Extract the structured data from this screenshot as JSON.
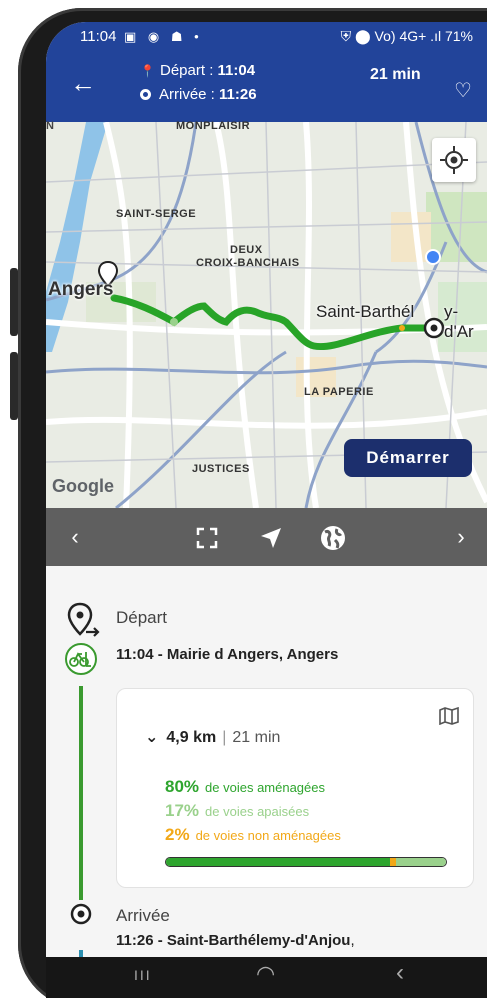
{
  "status_bar": {
    "time": "11:04",
    "left_icons": "▣ ◉ ☗ •",
    "right_text": "⛨ ⬤ Vo) 4G+ .ıl 71%"
  },
  "header": {
    "back_icon": "arrow-left-icon",
    "departure_label": "Départ : ",
    "departure_time": "11:04",
    "arrival_label": "Arrivée : ",
    "arrival_time": "11:26",
    "duration": "21 min",
    "favorite_icon": "heart-outline-icon"
  },
  "map": {
    "labels": {
      "monplaisir": "MONPLAISIR",
      "saint_serge": "SAINT-SERGE",
      "deux": "DEUX",
      "croix_banchais": "CROIX-BANCHAIS",
      "angers": "Angers",
      "saint_barth": "Saint-Barthél",
      "saint_barth_end": "y-d'Ar",
      "la_paperie": "LA PAPERIE",
      "justices": "JUSTICES",
      "n_corner": "N"
    },
    "start_button": "Démarrer",
    "google_logo": "Google",
    "route_color": "#28a428",
    "water_color": "#8fc3e8"
  },
  "toolbar": {
    "prev": "‹",
    "fullscreen_icon": "fullscreen-icon",
    "navigate_icon": "navigation-arrow-icon",
    "globe_icon": "globe-icon",
    "next": "›"
  },
  "itinerary": {
    "departure_heading": "Départ",
    "departure_detail": "11:04 - Mairie d Angers, Angers",
    "distance": "4,9 km",
    "duration": "21 min",
    "stats": [
      {
        "pct": "80%",
        "label": "de voies aménagées",
        "color": "#2ea52e"
      },
      {
        "pct": "17%",
        "label": "de voies apaisées",
        "color": "#9ad18c"
      },
      {
        "pct": "2%",
        "label": "de voies non aménagées",
        "color": "#f2a818"
      }
    ],
    "arrival_heading": "Arrivée",
    "arrival_detail_bold": "11:26 - Saint-Barthélemy-d'Anjou",
    "arrival_detail_rest": ","
  },
  "navbar": {
    "recents": "III",
    "home": "◠",
    "back": "‹"
  }
}
